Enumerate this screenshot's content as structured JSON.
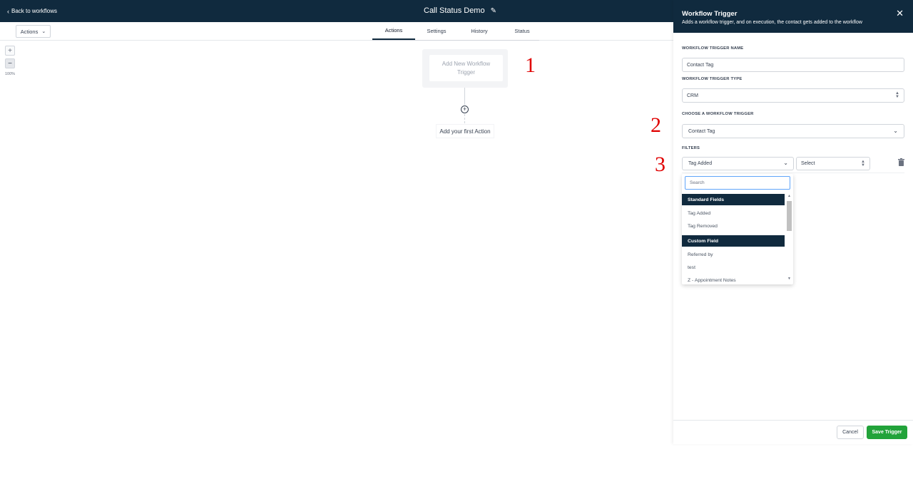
{
  "topbar": {
    "back_label": "Back to workflows",
    "workflow_title": "Call Status Demo"
  },
  "subbar": {
    "actions_label": "Actions",
    "tabs": [
      {
        "label": "Actions",
        "active": true
      },
      {
        "label": "Settings",
        "active": false
      },
      {
        "label": "History",
        "active": false
      },
      {
        "label": "Status",
        "active": false
      }
    ]
  },
  "zoom": {
    "in_label": "+",
    "out_label": "−",
    "level": "100%"
  },
  "canvas": {
    "trigger_placeholder": "Add New Workflow Trigger",
    "add_action_label": "Add your first Action",
    "plus_symbol": "+"
  },
  "annotations": [
    "1",
    "2",
    "3"
  ],
  "panel": {
    "title": "Workflow Trigger",
    "subtitle": "Adds a workflow trigger, and on execution, the contact gets added to the workflow",
    "trigger_name_label": "WORKFLOW TRIGGER NAME",
    "trigger_name_value": "Contact Tag",
    "trigger_type_label": "WORKFLOW TRIGGER TYPE",
    "trigger_type_value": "CRM",
    "choose_trigger_label": "CHOOSE A WORKFLOW TRIGGER",
    "choose_trigger_value": "Contact Tag",
    "filters_label": "FILTERS",
    "filter_field_value": "Tag Added",
    "filter_value_placeholder": "Select",
    "dropdown": {
      "search_placeholder": "Search",
      "groups": [
        {
          "name": "Standard Fields",
          "items": [
            "Tag Added",
            "Tag Removed"
          ]
        },
        {
          "name": "Custom Field",
          "items": [
            "Referred by",
            "test",
            "Z - Appointment Notes"
          ]
        }
      ]
    },
    "cancel_label": "Cancel",
    "save_label": "Save Trigger"
  },
  "colors": {
    "header_navy": "#102a3e",
    "save_green": "#22a33a",
    "annotation_red": "#e00000",
    "search_focus_blue": "#60a5fa"
  }
}
